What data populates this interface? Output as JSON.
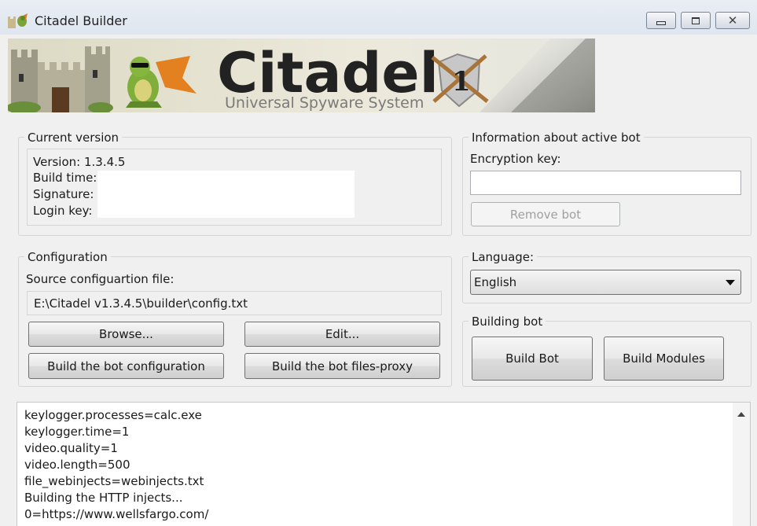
{
  "window": {
    "title": "Citadel Builder",
    "controls": [
      "minimize",
      "maximize",
      "close"
    ]
  },
  "banner": {
    "logo_text": "Citadel",
    "badge_text": "1",
    "tagline": "Universal Spyware System"
  },
  "current_version": {
    "title": "Current version",
    "version_label": "Version: 1.3.4.5",
    "build_time_label": "Build time:",
    "signature_label": "Signature:",
    "login_key_label": "Login key:"
  },
  "active_bot": {
    "title": "Information about active bot",
    "encryption_key_label": "Encryption key:",
    "encryption_key_value": "",
    "remove_bot_label": "Remove bot"
  },
  "configuration": {
    "title": "Configuration",
    "source_label": "Source configuartion file:",
    "source_path": "E:\\Citadel v1.3.4.5\\builder\\config.txt",
    "browse_label": "Browse...",
    "edit_label": "Edit...",
    "build_config_label": "Build the bot configuration",
    "build_files_proxy_label": "Build the bot files-proxy"
  },
  "language": {
    "title": "Language:",
    "selected": "English"
  },
  "building_bot": {
    "title": "Building bot",
    "build_bot_label": "Build Bot",
    "build_modules_label": "Build Modules"
  },
  "log": {
    "lines": [
      "keylogger.processes=calc.exe",
      "keylogger.time=1",
      "video.quality=1",
      "video.length=500",
      "file_webinjects=webinjects.txt",
      "Building the HTTP injects...",
      "0=https://www.wellsfargo.com/"
    ]
  },
  "colors": {
    "window_bg": "#f0f0f0",
    "banner_bg": "#e8e6d8",
    "logo_text": "#222222",
    "tagline_text": "#7a7a7a"
  }
}
